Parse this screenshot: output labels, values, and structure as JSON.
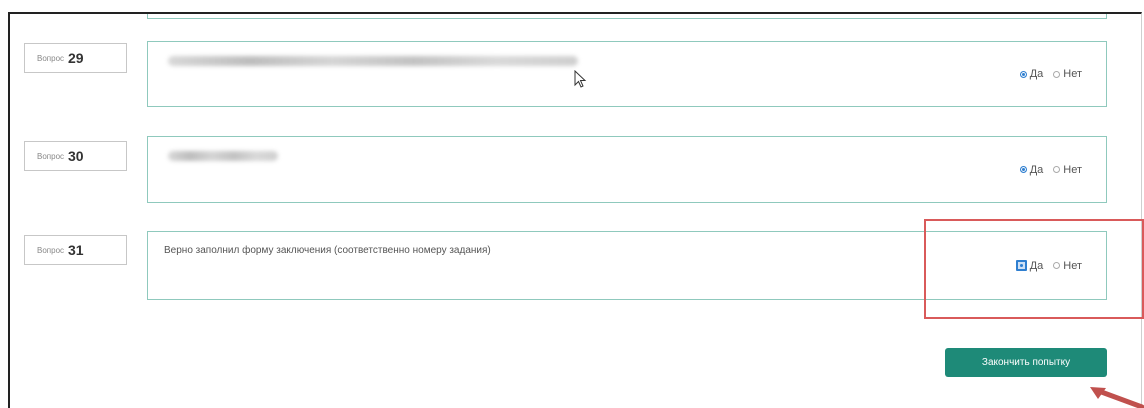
{
  "questions": [
    {
      "label": "Вопрос",
      "number": "29",
      "text": "",
      "answer_yes": "Да",
      "answer_no": "Нет",
      "selected": "yes"
    },
    {
      "label": "Вопрос",
      "number": "30",
      "text": "",
      "answer_yes": "Да",
      "answer_no": "Нет",
      "selected": "yes"
    },
    {
      "label": "Вопрос",
      "number": "31",
      "text": "Верно заполнил форму заключения (соответственно номеру задания)",
      "answer_yes": "Да",
      "answer_no": "Нет",
      "selected": "yes"
    }
  ],
  "finish_button": {
    "label": "Закончить попытку"
  },
  "colors": {
    "accent": "#1e8a78",
    "highlight": "#d95a5a",
    "radio": "#2f7fd0",
    "border": "#8fc9bd"
  }
}
